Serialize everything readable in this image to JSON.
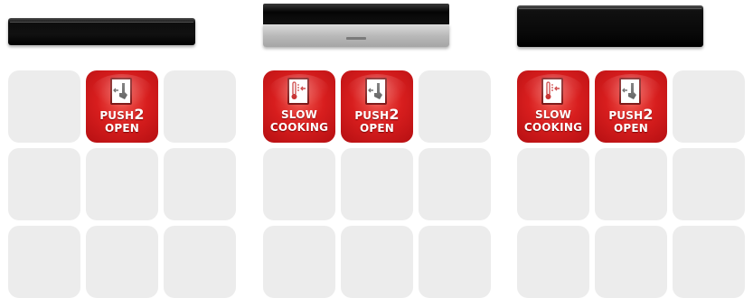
{
  "products": [
    {
      "image": "dark-flat-drawer",
      "features": [
        {
          "slot": 1,
          "icon": "push2open-icon",
          "line1": "PUSH",
          "sup": "2",
          "line2": "OPEN"
        }
      ]
    },
    {
      "image": "steel-front-drawer",
      "features": [
        {
          "slot": 0,
          "icon": "slow-cooking-icon",
          "line1": "SLOW",
          "line2": "COOKING"
        },
        {
          "slot": 1,
          "icon": "push2open-icon",
          "line1": "PUSH",
          "sup": "2",
          "line2": "OPEN"
        }
      ]
    },
    {
      "image": "dark-tall-drawer",
      "features": [
        {
          "slot": 0,
          "icon": "slow-cooking-icon",
          "line1": "SLOW",
          "line2": "COOKING"
        },
        {
          "slot": 1,
          "icon": "push2open-icon",
          "line1": "PUSH",
          "sup": "2",
          "line2": "OPEN"
        }
      ]
    }
  ],
  "colors": {
    "feature_red": "#d81e1e",
    "empty_tile": "#ececec"
  }
}
